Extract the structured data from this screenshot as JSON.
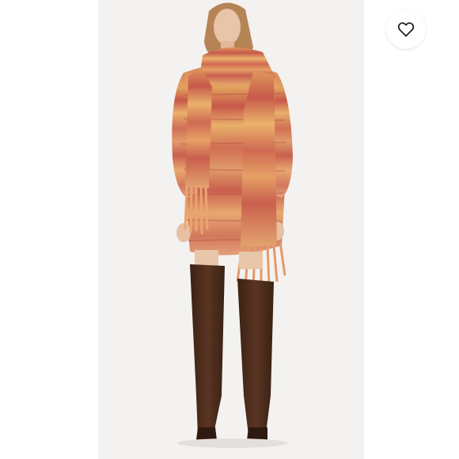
{
  "listing": {
    "photo": {
      "subject": "model-wearing-striped-knit-sweater-dress-scarf-and-brown-suede-boots",
      "colors": {
        "background": "#f3f2f0",
        "knit_primary": "#d9825f",
        "knit_secondary": "#e3a35e",
        "knit_accent": "#c7584a",
        "boots": "#4a2c1c"
      }
    },
    "like_button": {
      "icon": "heart-outline-icon",
      "liked": false
    }
  }
}
